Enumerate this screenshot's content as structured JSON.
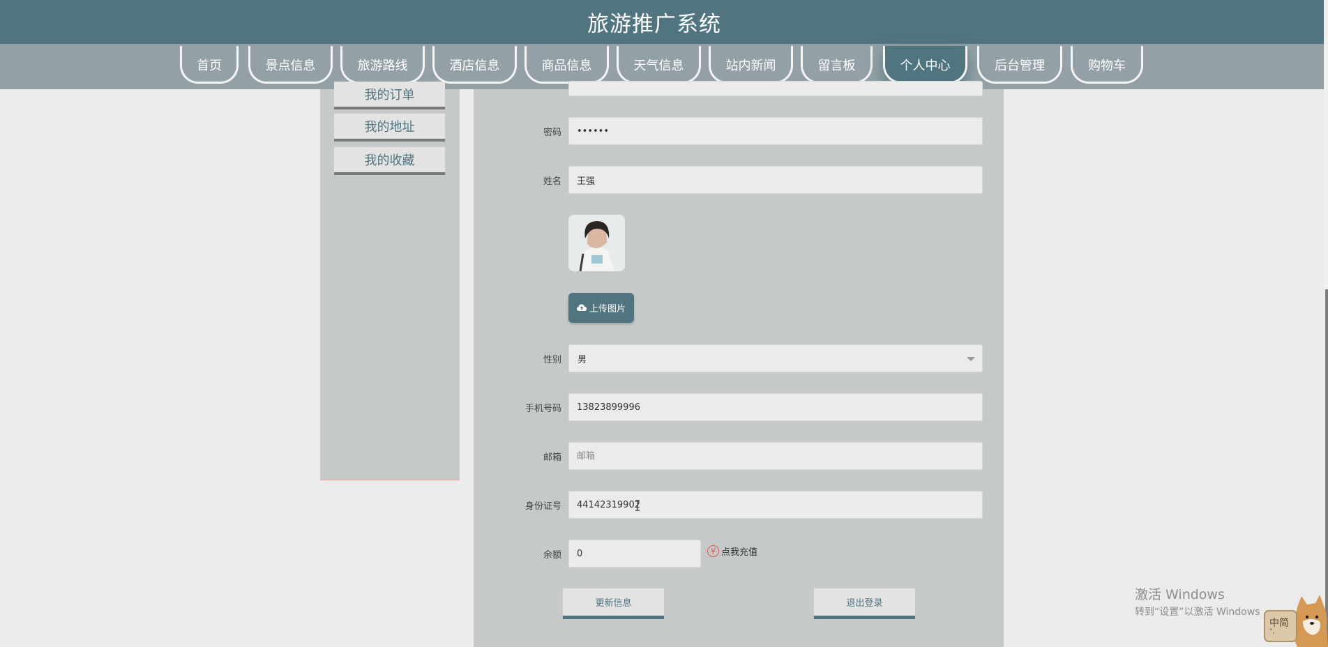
{
  "app": {
    "title": "旅游推广系统"
  },
  "nav": {
    "items": [
      {
        "label": "首页",
        "name": "nav-home"
      },
      {
        "label": "景点信息",
        "name": "nav-attractions"
      },
      {
        "label": "旅游路线",
        "name": "nav-routes"
      },
      {
        "label": "酒店信息",
        "name": "nav-hotels"
      },
      {
        "label": "商品信息",
        "name": "nav-products"
      },
      {
        "label": "天气信息",
        "name": "nav-weather"
      },
      {
        "label": "站内新闻",
        "name": "nav-news"
      },
      {
        "label": "留言板",
        "name": "nav-message-board"
      },
      {
        "label": "个人中心",
        "name": "nav-personal-center"
      },
      {
        "label": "后台管理",
        "name": "nav-admin"
      },
      {
        "label": "购物车",
        "name": "nav-cart"
      }
    ],
    "active_index": 8
  },
  "sidebar": {
    "items": [
      {
        "label": "我的订单"
      },
      {
        "label": "我的地址"
      },
      {
        "label": "我的收藏"
      }
    ]
  },
  "form": {
    "password": {
      "label": "密码",
      "value": "••••••"
    },
    "name": {
      "label": "姓名",
      "value": "王强"
    },
    "upload_label": "上传图片",
    "gender": {
      "label": "性别",
      "value": "男"
    },
    "phone": {
      "label": "手机号码",
      "value": "13823899996"
    },
    "email": {
      "label": "邮箱",
      "value": "",
      "placeholder": "邮箱"
    },
    "id_number": {
      "label": "身份证号",
      "value": "44142319902"
    },
    "balance": {
      "label": "余额",
      "value": "0"
    },
    "recharge_label": "点我充值",
    "recharge_icon": "¥",
    "update_label": "更新信息",
    "logout_label": "退出登录"
  },
  "watermark": {
    "line1": "激活 Windows",
    "line2": "转到“设置”以激活 Windows"
  },
  "ime": {
    "label": "中简",
    "sub": "°,"
  },
  "colors": {
    "header": "#507580",
    "nav": "#93a1a6",
    "panel": "#c5c9ca",
    "accent": "#507580",
    "recharge_icon": "#e05a4a"
  }
}
